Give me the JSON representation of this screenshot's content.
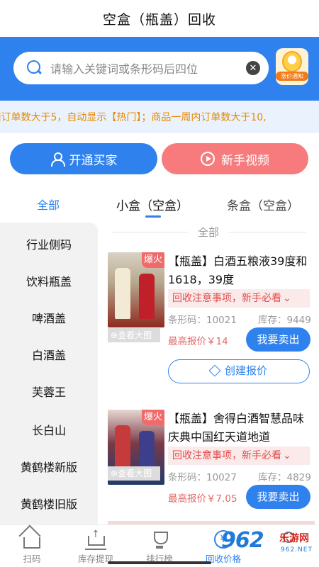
{
  "header": {
    "title": "空盒（瓶盖）回收"
  },
  "search": {
    "placeholder": "请输入关键词或条形码后四位",
    "clear_icon": "clear-icon",
    "notify_label": "涨价通知"
  },
  "marquee": {
    "text": "]订单数大于5，自动显示【热门】；商品一周内订单数大于10,"
  },
  "actions": {
    "buyer": "开通买家",
    "video": "新手视频"
  },
  "tabs": [
    {
      "label": "全部",
      "active": true
    },
    {
      "label": "小盒（空盒）",
      "selected": true
    },
    {
      "label": "条盒（空盒）",
      "selected": false
    }
  ],
  "sidebar": {
    "items": [
      "行业侧码",
      "饮料瓶盖",
      "啤酒盖",
      "白酒盖",
      "芙蓉王",
      "长白山",
      "黄鹤楼新版",
      "黄鹤楼旧版"
    ]
  },
  "list": {
    "section_label": "全部",
    "items": [
      {
        "badge": "爆火",
        "zoom": "查看大图",
        "title": "【瓶盖】白酒五粮液39度和1618，39度",
        "notice": "回收注意事项，新手必看",
        "code": "条形码：10021",
        "stock": "库存：9449",
        "price": "最高报价￥14",
        "sell": "我要卖出",
        "quote": "创建报价"
      },
      {
        "badge": "爆火",
        "zoom": "查看大图",
        "title": "【瓶盖】舍得白酒智慧品味庆典中国红天道地道",
        "notice": "回收注意事项，新手必看",
        "code": "条形码：10027",
        "stock": "库存：4829",
        "price": "最高报价￥7.05",
        "sell": "我要卖出"
      }
    ]
  },
  "bottom_nav": [
    {
      "label": "扫码",
      "icon": "home-icon"
    },
    {
      "label": "库存提现",
      "icon": "cart-icon"
    },
    {
      "label": "排行榜",
      "icon": "trophy-icon"
    },
    {
      "label": "回收价格",
      "icon": "yen-icon",
      "active": true
    },
    {
      "label": "",
      "icon": "profile-icon"
    }
  ],
  "watermark": {
    "logo": "962",
    "cn": "乐游网",
    "url": "962.NET"
  },
  "colors": {
    "primary": "#2f82ee",
    "accent": "#f77b7d",
    "warning": "#e68a00"
  }
}
